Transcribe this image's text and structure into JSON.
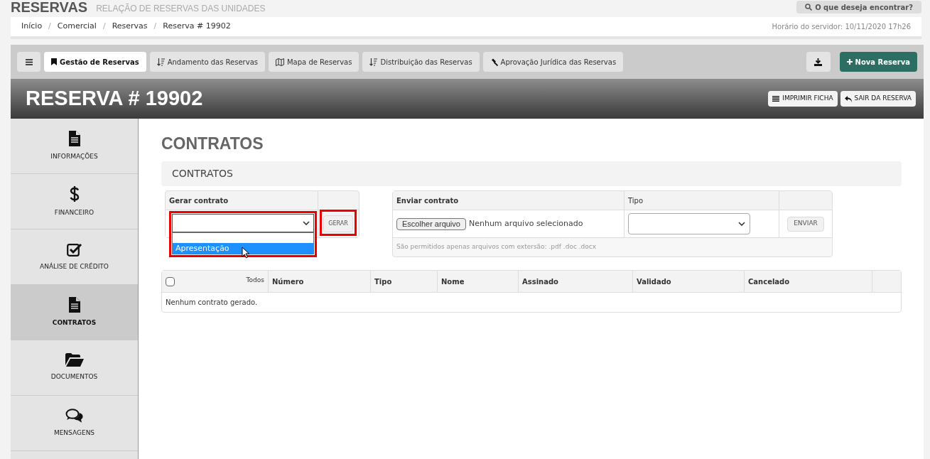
{
  "header": {
    "title": "RESERVAS",
    "subtitle": "RELAÇÃO DE RESERVAS DAS UNIDADES",
    "search_button": "O que deseja encontrar?"
  },
  "breadcrumb": [
    {
      "label": "Início"
    },
    {
      "separator": "/",
      "label": "Comercial"
    },
    {
      "separator": "/",
      "label": "Reservas"
    },
    {
      "separator": "/",
      "label": "Reserva # 19902"
    }
  ],
  "server_time": "Horário do servidor: 10/11/2020 17h26",
  "tabs": [
    {
      "label": "Gestão de Reservas",
      "selected": true
    },
    {
      "label": "Andamento das Reservas",
      "selected": false
    },
    {
      "label": "Mapa de Reservas",
      "selected": false
    },
    {
      "label": "Distribuição das Reservas",
      "selected": false
    },
    {
      "label": "Aprovação Jurídica das Reservas",
      "selected": false
    }
  ],
  "new_button": "Nova Reserva",
  "reserva_title": "RESERVA # 19902",
  "actions": [
    "IMPRIMIR FICHA",
    "SAIR DA RESERVA"
  ],
  "sidebar": [
    {
      "label": "INFORMAÇÕES",
      "selected": false
    },
    {
      "label": "FINANCEIRO",
      "selected": false
    },
    {
      "label": "ANÁLISE DE CRÉDITO",
      "selected": false
    },
    {
      "label": "CONTRATOS",
      "selected": true
    },
    {
      "label": "DOCUMENTOS",
      "selected": false
    },
    {
      "label": "MENSAGENS",
      "selected": false
    }
  ],
  "page_title": "CONTRATOS",
  "section_title": "CONTRATOS",
  "generate": {
    "header": "Gerar contrato",
    "select_expanded": true,
    "select_highlighted": true,
    "options": [
      {
        "label": "Apresentação",
        "selected": true
      }
    ],
    "button": "GERAR",
    "button_highlighted": true
  },
  "upload": {
    "header": "Enviar contrato",
    "type_header": "Tipo",
    "file_button": "Escolher arquivo",
    "file_status": "Nenhum arquivo selecionado",
    "send_button": "ENVIAR",
    "hint": "São permitidos apenas arquivos com extersão: .pdf .doc .docx"
  },
  "table": {
    "select_all_label": "Todos",
    "select_all_checked": false,
    "columns": [
      "Número",
      "Tipo",
      "Nome",
      "Assinado",
      "Validado",
      "Cancelado"
    ],
    "empty_message": "Nenhum contrato gerado."
  }
}
